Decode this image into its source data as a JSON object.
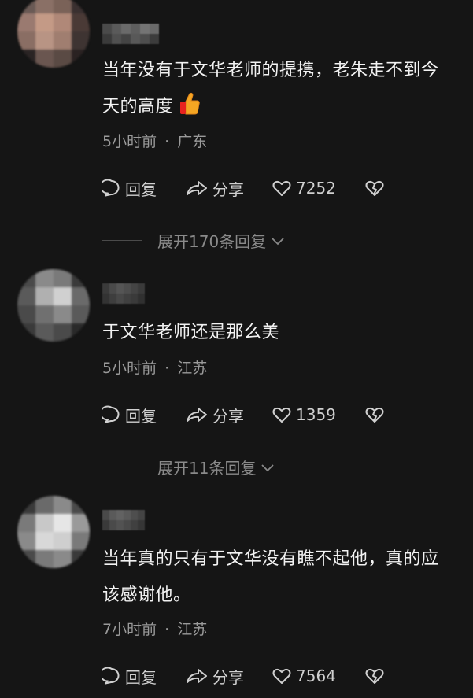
{
  "comments": [
    {
      "text_lines": [
        "当年没有于文华老师的提携，老朱走不到今",
        "天的高度"
      ],
      "emoji": "thumbs-up-icon",
      "time": "5小时前",
      "location": "广东",
      "reply_label": "回复",
      "share_label": "分享",
      "likes": "7252",
      "expand_label": "展开170条回复"
    },
    {
      "text_lines": [
        "于文华老师还是那么美"
      ],
      "time": "5小时前",
      "location": "江苏",
      "reply_label": "回复",
      "share_label": "分享",
      "likes": "1359",
      "expand_label": "展开11条回复"
    },
    {
      "text_lines": [
        "当年真的只有于文华没有瞧不起他，真的应",
        "该感谢他。"
      ],
      "time": "7小时前",
      "location": "江苏",
      "reply_label": "回复",
      "share_label": "分享",
      "likes": "7564"
    }
  ],
  "meta_separator": "·",
  "colors": {
    "background": "#151515",
    "text_primary": "#f2f2f2",
    "text_meta": "#9a9a9a",
    "text_expand": "#8a8a8a",
    "action_text": "#d0d0d0"
  }
}
